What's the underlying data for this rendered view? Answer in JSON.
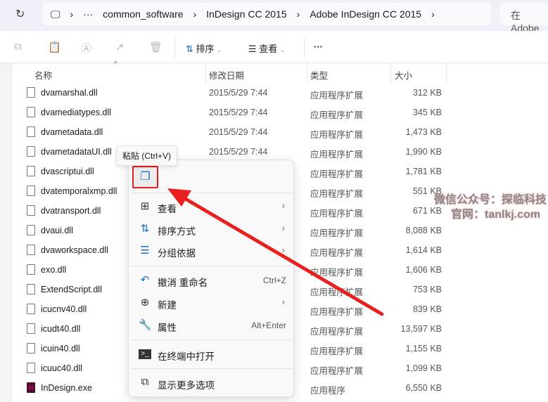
{
  "address": {
    "breadcrumbs": [
      "common_software",
      "InDesign CC 2015",
      "Adobe InDesign CC 2015"
    ],
    "search_placeholder": "在 Adobe"
  },
  "toolbar": {
    "sort": "排序",
    "view": "查看",
    "more": "···"
  },
  "columns": {
    "name": "名称",
    "date": "修改日期",
    "type": "类型",
    "size": "大小"
  },
  "files": [
    {
      "name": "dvamarshal.dll",
      "date": "2015/5/29 7:44",
      "type": "应用程序扩展",
      "size": "312 KB"
    },
    {
      "name": "dvamediatypes.dll",
      "date": "2015/5/29 7:44",
      "type": "应用程序扩展",
      "size": "345 KB"
    },
    {
      "name": "dvametadata.dll",
      "date": "2015/5/29 7:44",
      "type": "应用程序扩展",
      "size": "1,473 KB"
    },
    {
      "name": "dvametadataUI.dll",
      "date": "2015/5/29 7:44",
      "type": "应用程序扩展",
      "size": "1,990 KB"
    },
    {
      "name": "dvascriptui.dll",
      "date": "",
      "type": "应用程序扩展",
      "size": "1,781 KB"
    },
    {
      "name": "dvatemporalxmp.dll",
      "date": "",
      "type": "应用程序扩展",
      "size": "551 KB"
    },
    {
      "name": "dvatransport.dll",
      "date": "",
      "type": "应用程序扩展",
      "size": "671 KB"
    },
    {
      "name": "dvaui.dll",
      "date": "",
      "type": "应用程序扩展",
      "size": "8,088 KB"
    },
    {
      "name": "dvaworkspace.dll",
      "date": "",
      "type": "应用程序扩展",
      "size": "1,614 KB"
    },
    {
      "name": "exo.dll",
      "date": "",
      "type": "应用程序扩展",
      "size": "1,606 KB"
    },
    {
      "name": "ExtendScript.dll",
      "date": "",
      "type": "应用程序扩展",
      "size": "753 KB"
    },
    {
      "name": "icucnv40.dll",
      "date": "",
      "type": "应用程序扩展",
      "size": "839 KB"
    },
    {
      "name": "icudt40.dll",
      "date": "",
      "type": "应用程序扩展",
      "size": "13,597 KB"
    },
    {
      "name": "icuin40.dll",
      "date": "",
      "type": "应用程序扩展",
      "size": "1,155 KB"
    },
    {
      "name": "icuuc40.dll",
      "date": "",
      "type": "应用程序扩展",
      "size": "1,099 KB"
    },
    {
      "name": "InDesign.exe",
      "date": "",
      "type": "应用程序",
      "size": "6,550 KB"
    }
  ],
  "tooltip": "粘贴 (Ctrl+V)",
  "menu": {
    "view": "查看",
    "sort": "排序方式",
    "group": "分组依据",
    "undo": "撤消 重命名",
    "undo_shortcut": "Ctrl+Z",
    "new": "新建",
    "properties": "属性",
    "properties_shortcut": "Alt+Enter",
    "terminal": "在终端中打开",
    "more": "显示更多选项"
  },
  "watermark": {
    "line1": "微信公众号：探临科技",
    "line2": "官网：tanlkj.com"
  },
  "colors": {
    "accent": "#1a6fd0",
    "highlight": "#e02020"
  }
}
